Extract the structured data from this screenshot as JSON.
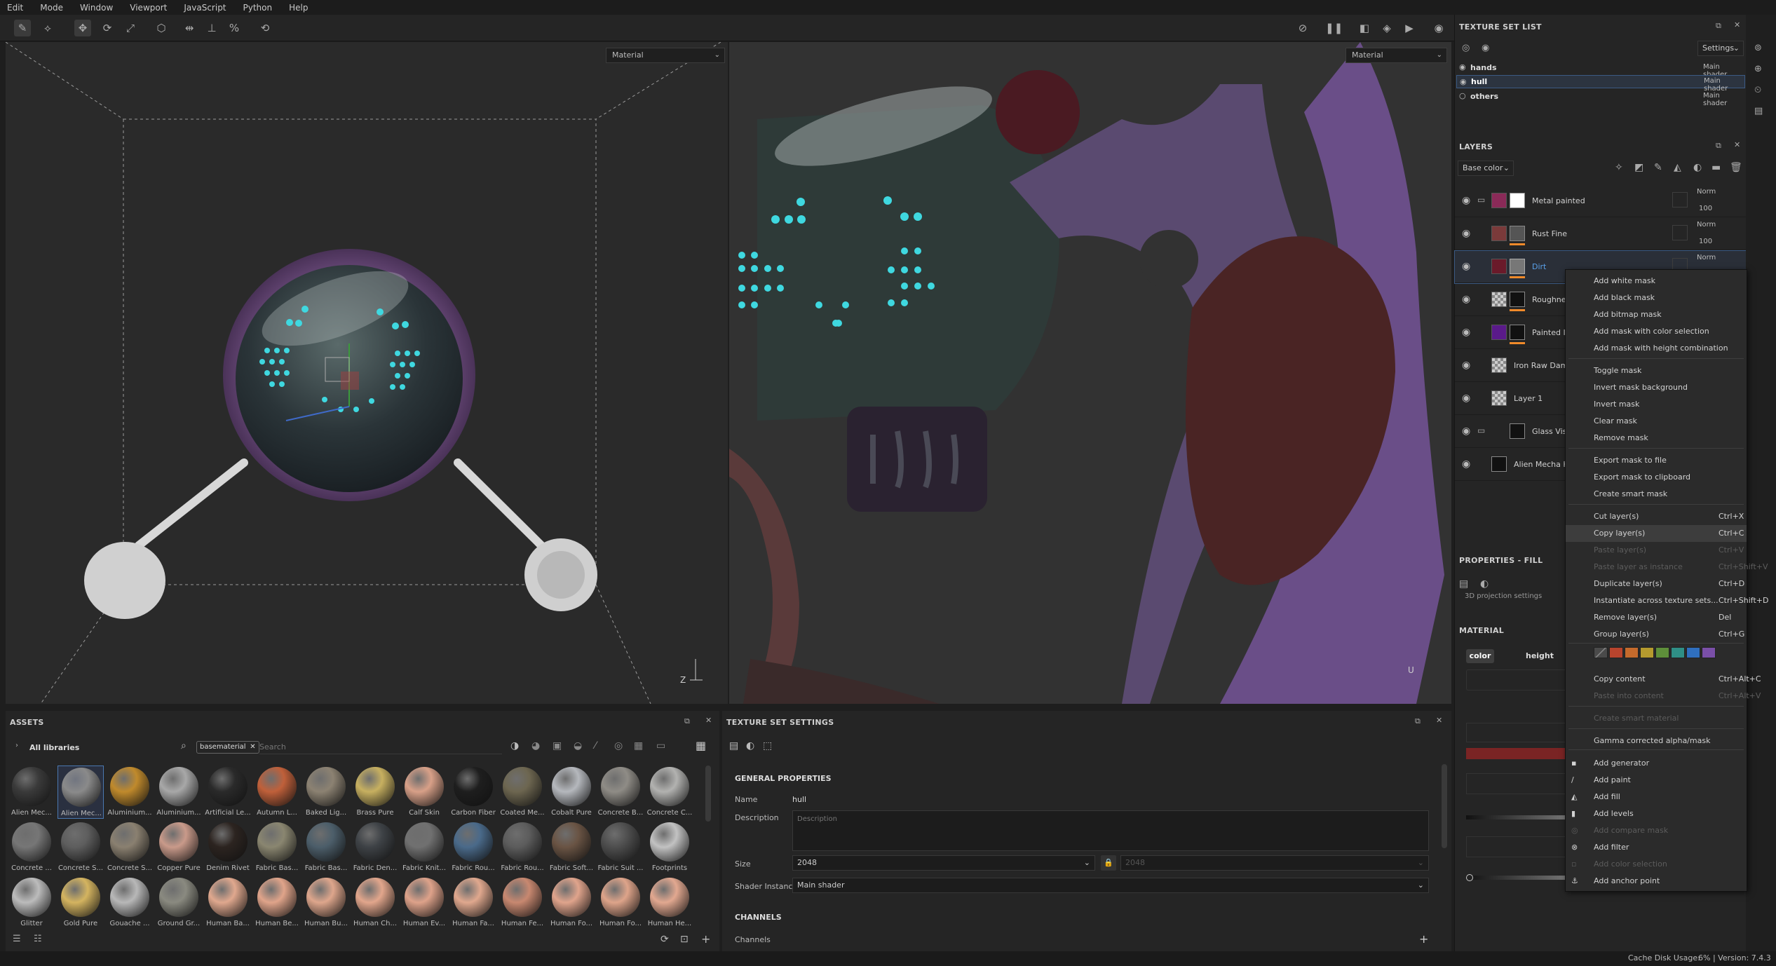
{
  "menubar": {
    "items": [
      "Edit",
      "Mode",
      "Window",
      "Viewport",
      "JavaScript",
      "Python",
      "Help"
    ]
  },
  "viewport3d": {
    "material_select": "Material"
  },
  "viewport2d": {
    "material_select": "Material"
  },
  "texture_set_list": {
    "title": "TEXTURE SET LIST",
    "settings_label": "Settings",
    "rows": [
      {
        "name": "hands",
        "shader": "Main shader"
      },
      {
        "name": "hull",
        "shader": "Main shader"
      },
      {
        "name": "others",
        "shader": "Main shader"
      }
    ]
  },
  "layers": {
    "title": "LAYERS",
    "channel_select": "Base color",
    "rows": [
      {
        "name": "Metal painted",
        "blend": "Norm",
        "opacity": "100"
      },
      {
        "name": "Rust Fine",
        "blend": "Norm",
        "opacity": "100"
      },
      {
        "name": "Dirt",
        "blend": "Norm",
        "opacity": ""
      },
      {
        "name": "Roughness",
        "blend": "",
        "opacity": ""
      },
      {
        "name": "Painted Iron",
        "blend": "",
        "opacity": ""
      },
      {
        "name": "Iron Raw Damaged",
        "blend": "",
        "opacity": ""
      },
      {
        "name": "Layer 1",
        "blend": "",
        "opacity": ""
      },
      {
        "name": "Glass Visor",
        "blend": "",
        "opacity": ""
      },
      {
        "name": "Alien Mecha Hull",
        "blend": "",
        "opacity": ""
      }
    ]
  },
  "properties": {
    "title": "PROPERTIES - FILL",
    "projection_label": "3D projection settings",
    "material_heading": "MATERIAL",
    "channel_buttons": [
      "color",
      "height"
    ]
  },
  "context_menu": {
    "items": [
      {
        "label": "Add white mask",
        "shortcut": "",
        "disabled": false
      },
      {
        "label": "Add black mask",
        "shortcut": "",
        "disabled": false
      },
      {
        "label": "Add bitmap mask",
        "shortcut": "",
        "disabled": false
      },
      {
        "label": "Add mask with color selection",
        "shortcut": "",
        "disabled": false
      },
      {
        "label": "Add mask with height combination",
        "shortcut": "",
        "disabled": false
      },
      {
        "label": "Toggle mask",
        "shortcut": "",
        "disabled": false
      },
      {
        "label": "Invert mask background",
        "shortcut": "",
        "disabled": false
      },
      {
        "label": "Invert mask",
        "shortcut": "",
        "disabled": false
      },
      {
        "label": "Clear mask",
        "shortcut": "",
        "disabled": false
      },
      {
        "label": "Remove mask",
        "shortcut": "",
        "disabled": false
      },
      {
        "label": "Export mask to file",
        "shortcut": "",
        "disabled": false
      },
      {
        "label": "Export mask to clipboard",
        "shortcut": "",
        "disabled": false
      },
      {
        "label": "Create smart mask",
        "shortcut": "",
        "disabled": false
      },
      {
        "label": "Cut layer(s)",
        "shortcut": "Ctrl+X",
        "disabled": false
      },
      {
        "label": "Copy layer(s)",
        "shortcut": "Ctrl+C",
        "disabled": false
      },
      {
        "label": "Paste layer(s)",
        "shortcut": "Ctrl+V",
        "disabled": true
      },
      {
        "label": "Paste layer as instance",
        "shortcut": "Ctrl+Shift+V",
        "disabled": true
      },
      {
        "label": "Duplicate layer(s)",
        "shortcut": "Ctrl+D",
        "disabled": false
      },
      {
        "label": "Instantiate across texture sets...",
        "shortcut": "Ctrl+Shift+D",
        "disabled": false
      },
      {
        "label": "Remove layer(s)",
        "shortcut": "Del",
        "disabled": false
      },
      {
        "label": "Group layer(s)",
        "shortcut": "Ctrl+G",
        "disabled": false
      },
      {
        "label": "Copy content",
        "shortcut": "Ctrl+Alt+C",
        "disabled": false
      },
      {
        "label": "Paste into content",
        "shortcut": "Ctrl+Alt+V",
        "disabled": true
      },
      {
        "label": "Create smart material",
        "shortcut": "",
        "disabled": true
      },
      {
        "label": "Gamma corrected alpha/mask",
        "shortcut": "",
        "disabled": false
      },
      {
        "label": "Add generator",
        "shortcut": "",
        "disabled": false
      },
      {
        "label": "Add paint",
        "shortcut": "",
        "disabled": false
      },
      {
        "label": "Add fill",
        "shortcut": "",
        "disabled": false
      },
      {
        "label": "Add levels",
        "shortcut": "",
        "disabled": false
      },
      {
        "label": "Add compare mask",
        "shortcut": "",
        "disabled": true
      },
      {
        "label": "Add filter",
        "shortcut": "",
        "disabled": false
      },
      {
        "label": "Add color selection",
        "shortcut": "",
        "disabled": true
      },
      {
        "label": "Add anchor point",
        "shortcut": "",
        "disabled": false
      }
    ],
    "swatch_colors": [
      "#5a5a5a",
      "#b8442d",
      "#c46a2c",
      "#b59a2e",
      "#5e8f3a",
      "#2f8f86",
      "#2f6fbf",
      "#7a4fa8"
    ]
  },
  "assets": {
    "title": "ASSETS",
    "library_label": "All libraries",
    "filter_tag": "basematerial",
    "search_placeholder": "Search",
    "items": [
      {
        "label": "Alien Mec...",
        "color": "#3a3a3a"
      },
      {
        "label": "Alien Mec...",
        "color": "#8a8a8a"
      },
      {
        "label": "Aluminium...",
        "color": "#c08a2c"
      },
      {
        "label": "Aluminium...",
        "color": "#a8a8a8"
      },
      {
        "label": "Artificial Le...",
        "color": "#2a2a2a"
      },
      {
        "label": "Autumn L...",
        "color": "#c0603a"
      },
      {
        "label": "Baked Lig...",
        "color": "#8c8272"
      },
      {
        "label": "Brass Pure",
        "color": "#c7b060"
      },
      {
        "label": "Calf Skin",
        "color": "#d8a088"
      },
      {
        "label": "Carbon Fiber",
        "color": "#1e1e1e"
      },
      {
        "label": "Coated Me...",
        "color": "#6d6650"
      },
      {
        "label": "Cobalt Pure",
        "color": "#b5b8bd"
      },
      {
        "label": "Concrete B...",
        "color": "#8f8c86"
      },
      {
        "label": "Concrete C...",
        "color": "#b2b2b0"
      },
      {
        "label": "Concrete ...",
        "color": "#767676"
      },
      {
        "label": "Concrete S...",
        "color": "#5e5e5e"
      },
      {
        "label": "Concrete S...",
        "color": "#8a8070"
      },
      {
        "label": "Copper Pure",
        "color": "#c99a8a"
      },
      {
        "label": "Denim Rivet",
        "color": "#2c2420"
      },
      {
        "label": "Fabric Bas...",
        "color": "#8a8670"
      },
      {
        "label": "Fabric Bas...",
        "color": "#4c5e6a"
      },
      {
        "label": "Fabric Den...",
        "color": "#3e4246"
      },
      {
        "label": "Fabric Knit...",
        "color": "#707070"
      },
      {
        "label": "Fabric Rou...",
        "color": "#4a6a8a"
      },
      {
        "label": "Fabric Rou...",
        "color": "#5c5c5c"
      },
      {
        "label": "Fabric Soft...",
        "color": "#6a5444"
      },
      {
        "label": "Fabric Suit ...",
        "color": "#4e4e4e"
      },
      {
        "label": "Footprints",
        "color": "#c2c2c2"
      },
      {
        "label": "Glitter",
        "color": "#bcbcbc"
      },
      {
        "label": "Gold Pure",
        "color": "#d4b460"
      },
      {
        "label": "Gouache ...",
        "color": "#b8b8b8"
      },
      {
        "label": "Ground Gr...",
        "color": "#8a8a80"
      },
      {
        "label": "Human Ba...",
        "color": "#e0a88e"
      },
      {
        "label": "Human Be...",
        "color": "#e0a48a"
      },
      {
        "label": "Human Bu...",
        "color": "#dea68c"
      },
      {
        "label": "Human Ch...",
        "color": "#e2a68c"
      },
      {
        "label": "Human Ev...",
        "color": "#dea28a"
      },
      {
        "label": "Human Fa...",
        "color": "#e0a88e"
      },
      {
        "label": "Human Fe...",
        "color": "#c88870"
      },
      {
        "label": "Human Fo...",
        "color": "#e0a48c"
      },
      {
        "label": "Human Fo...",
        "color": "#dea48a"
      },
      {
        "label": "Human He...",
        "color": "#e2a890"
      }
    ]
  },
  "texture_set_settings": {
    "title": "TEXTURE SET SETTINGS",
    "general_heading": "GENERAL PROPERTIES",
    "name_label": "Name",
    "name_value": "hull",
    "description_label": "Description",
    "description_placeholder": "Description",
    "size_label": "Size",
    "size_value": "2048",
    "size_value_locked": "2048",
    "shader_label": "Shader Instance",
    "shader_value": "Main shader",
    "channels_heading": "CHANNELS",
    "channels_label": "Channels"
  },
  "status": {
    "cache_label": "Cache Disk Usage:",
    "usage_version": "6% | Version: 7.4.3"
  }
}
